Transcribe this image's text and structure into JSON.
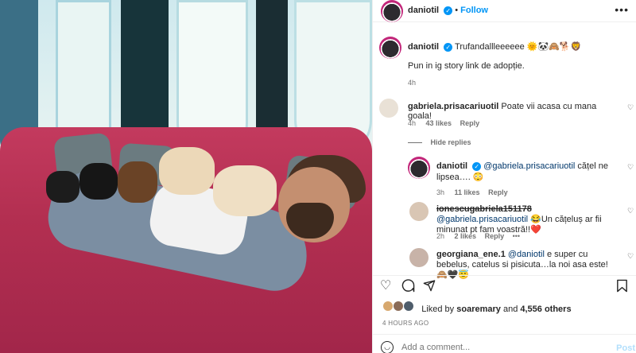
{
  "post": {
    "username": "daniotil",
    "follow_label": "Follow",
    "caption": "Trufandallleeeeee 🌞🐼🙈🐕🦁",
    "second_line": "Pun in ig story link de adopție.",
    "time": "4h"
  },
  "comments": [
    {
      "username": "gabriela.prisacariuotil",
      "text": "Poate vii acasa cu mana goala!",
      "time": "4h",
      "likes": "43 likes",
      "reply": "Reply"
    }
  ],
  "hide_replies": "Hide replies",
  "replies": [
    {
      "username": "daniotil",
      "mention": "@gabriela.prisacariuotil",
      "text": "cățel ne lipsea…. 😳",
      "time": "3h",
      "likes": "11 likes",
      "reply": "Reply"
    },
    {
      "username": "ionescugabriela151178",
      "mention": "@gabriela.prisacariuotil",
      "text": "😂Un cățeluș ar fii minunat pt fam voastră!!❤️",
      "time": "2h",
      "likes": "2 likes",
      "reply": "Reply",
      "more": "•••"
    },
    {
      "username": "georgiana_ene.1",
      "mention": "@daniotil",
      "text": "e super cu bebelus, catelus si pisicuta…la noi asa este! 🙈🖤😇"
    }
  ],
  "likes": {
    "prefix": "Liked by",
    "user": "soaremary",
    "joiner": "and",
    "others": "4,556 others"
  },
  "timestamp": "4 HOURS AGO",
  "add_comment": {
    "placeholder": "Add a comment...",
    "post_label": "Post"
  },
  "icons": [
    "heart-icon",
    "comment-icon",
    "share-icon",
    "bookmark-icon",
    "emoji-icon",
    "ellipsis-icon",
    "verified-icon"
  ],
  "colors": {
    "accent": "#0095f6",
    "mention": "#00376b"
  }
}
